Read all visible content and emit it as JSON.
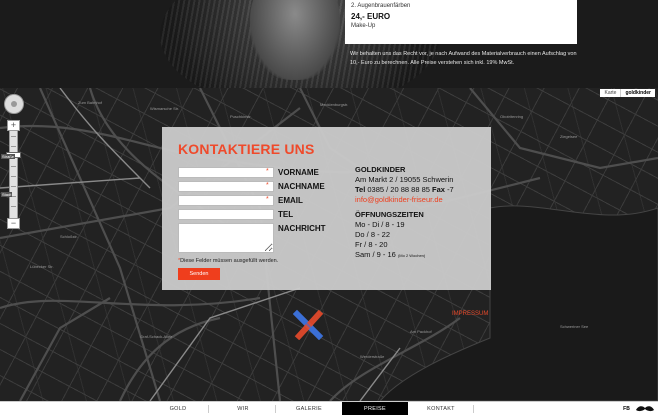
{
  "prices": {
    "line_a": "2. Augenbrauenfärben",
    "price": "24,- EURO",
    "line_b": "Make-Up",
    "note": "Wir behalten uns das Recht vor, je nach Aufwand des Materialverbrauch einen Aufschlag von 10,- Euro zu berechnen. Alle Preise verstehen sich inkl. 19% MwSt."
  },
  "map": {
    "type_options": [
      "Karte",
      "goldkinder"
    ],
    "zoom_labels": [
      "Straße",
      "Stadt"
    ],
    "streets": [
      "Zum Bahnhof",
      "Wismarsche Str.",
      "Puschkinstr.",
      "Mecklenburgstr.",
      "Schloßstr.",
      "Werderstraße",
      "Lübecker Str.",
      "Obotritenring",
      "Graf-Schack-Allee",
      "Am Packhof",
      "Ziegelsee",
      "Schweriner See"
    ],
    "impressum": "IMPRESSUM"
  },
  "contact": {
    "title": "KONTAKTIERE UNS",
    "fields": [
      {
        "label": "VORNAME",
        "required": "*"
      },
      {
        "label": "NACHNAME",
        "required": "*"
      },
      {
        "label": "EMAIL",
        "required": "*"
      },
      {
        "label": "TEL",
        "required": ""
      }
    ],
    "message_label": "NACHRICHT",
    "note_star": "*",
    "note": "Diese Felder müssen ausgefüllt werden.",
    "send": "Senden"
  },
  "info": {
    "company": "GOLDKINDER",
    "address": "Am Markt 2 / 19055 Schwerin",
    "tel_label": "Tel",
    "tel_number": "0385 / 20 88 88 85",
    "fax_label": "Fax",
    "fax_number": "-7",
    "email": "info@goldkinder-friseur.de",
    "hours_title": "ÖFFNUNGSZEITEN",
    "hours": [
      "Mo - Di / 8 - 19",
      "Do / 8 - 22",
      "Fr / 8 - 20"
    ],
    "hours_sat": "Sam / 9 - 16",
    "hours_sat_note": "(Mo 2 Wochen)"
  },
  "nav": {
    "items": [
      "GOLD",
      "WIR",
      "GALERIE",
      "PREISE",
      "KONTAKT"
    ],
    "active": "PREISE",
    "fb": "FB"
  },
  "colors": {
    "accent": "#ef3e1d",
    "nav_active": "#000000"
  }
}
